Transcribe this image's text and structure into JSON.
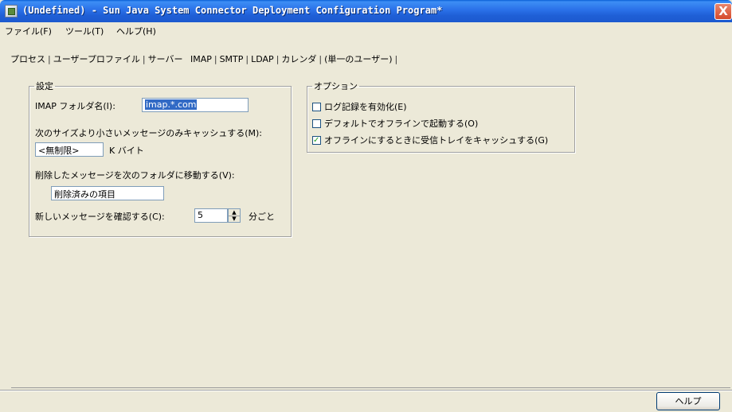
{
  "window": {
    "title": "(Undefined) - Sun Java System Connector Deployment Configuration Program*",
    "close_label": "X"
  },
  "menu": {
    "items": [
      "ファイル(F)",
      "ツール(T)",
      "ヘルプ(H)"
    ]
  },
  "tabs": [
    "プロセス",
    "ユーザープロファイル",
    "サーバー",
    "IMAP",
    "SMTP",
    "LDAP",
    "カレンダ",
    "(単一のユーザー)"
  ],
  "active_tab": "IMAP",
  "settings": {
    "legend": "設定",
    "imap_folder_label": "IMAP フォルダ名(I):",
    "imap_folder_value": "imap.*.com",
    "cache_size_label": "次のサイズより小さいメッセージのみキャッシュする(M):",
    "cache_size_value": "<無制限>",
    "cache_size_unit": "K バイト",
    "deleted_move_label": "削除したメッセージを次のフォルダに移動する(V):",
    "deleted_folder_value": "削除済みの項目",
    "check_new_label": "新しいメッセージを確認する(C):",
    "check_new_value": "5",
    "check_new_unit": "分ごと"
  },
  "options": {
    "legend": "オプション",
    "items": [
      {
        "label": "ログ記録を有効化(E)",
        "checked": false
      },
      {
        "label": "デフォルトでオフラインで起動する(O)",
        "checked": false
      },
      {
        "label": "オフラインにするときに受信トレイをキャッシュする(G)",
        "checked": true
      }
    ]
  },
  "footer": {
    "help_label": "ヘルプ"
  }
}
